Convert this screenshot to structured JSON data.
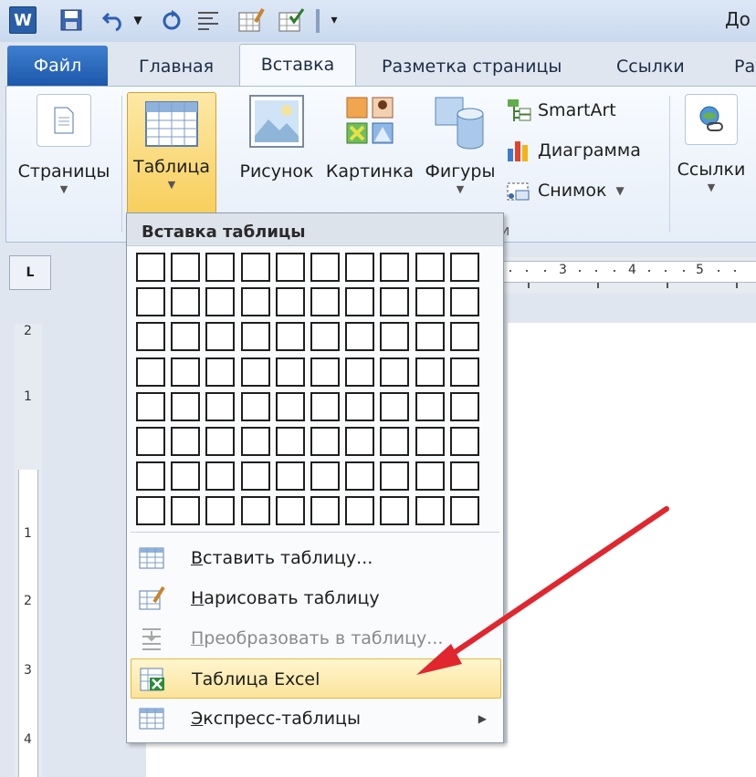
{
  "title_bar": {
    "doc_title": "До"
  },
  "tabs": {
    "file": "Файл",
    "home": "Главная",
    "insert": "Вставка",
    "page_layout": "Разметка страницы",
    "references": "Ссылки",
    "partial": "Ра"
  },
  "ribbon": {
    "pages": "Страницы",
    "table": "Таблица",
    "picture": "Рисунок",
    "clipart": "Картинка",
    "shapes": "Фигуры",
    "smartart": "SmartArt",
    "chart": "Диаграмма",
    "screenshot": "Снимок",
    "links": "Ссылки"
  },
  "ruler": {
    "corner": "L",
    "h_numbers": [
      "3",
      "4",
      "5"
    ],
    "v_numbers": [
      "2",
      "1",
      "1",
      "2",
      "3",
      "4"
    ]
  },
  "menu": {
    "header": "Вставка таблицы",
    "grid_cols": 10,
    "grid_rows": 8,
    "items": [
      {
        "accel": "В",
        "rest": "ставить таблицу...",
        "state": "normal"
      },
      {
        "accel": "Н",
        "rest": "арисовать таблицу",
        "state": "normal"
      },
      {
        "accel": "П",
        "rest": "реобразовать в таблицу...",
        "state": "disabled"
      },
      {
        "accel": "",
        "rest": "Таблица Excel",
        "state": "hover"
      },
      {
        "accel": "Э",
        "rest": "кспресс-таблицы",
        "state": "normal",
        "submenu": true
      }
    ]
  },
  "colors": {
    "file_tab": "#1d58ab",
    "highlight": "#fbe39a",
    "annotation_arrow": "#e0262e"
  },
  "icons": {
    "word_logo": "W"
  }
}
